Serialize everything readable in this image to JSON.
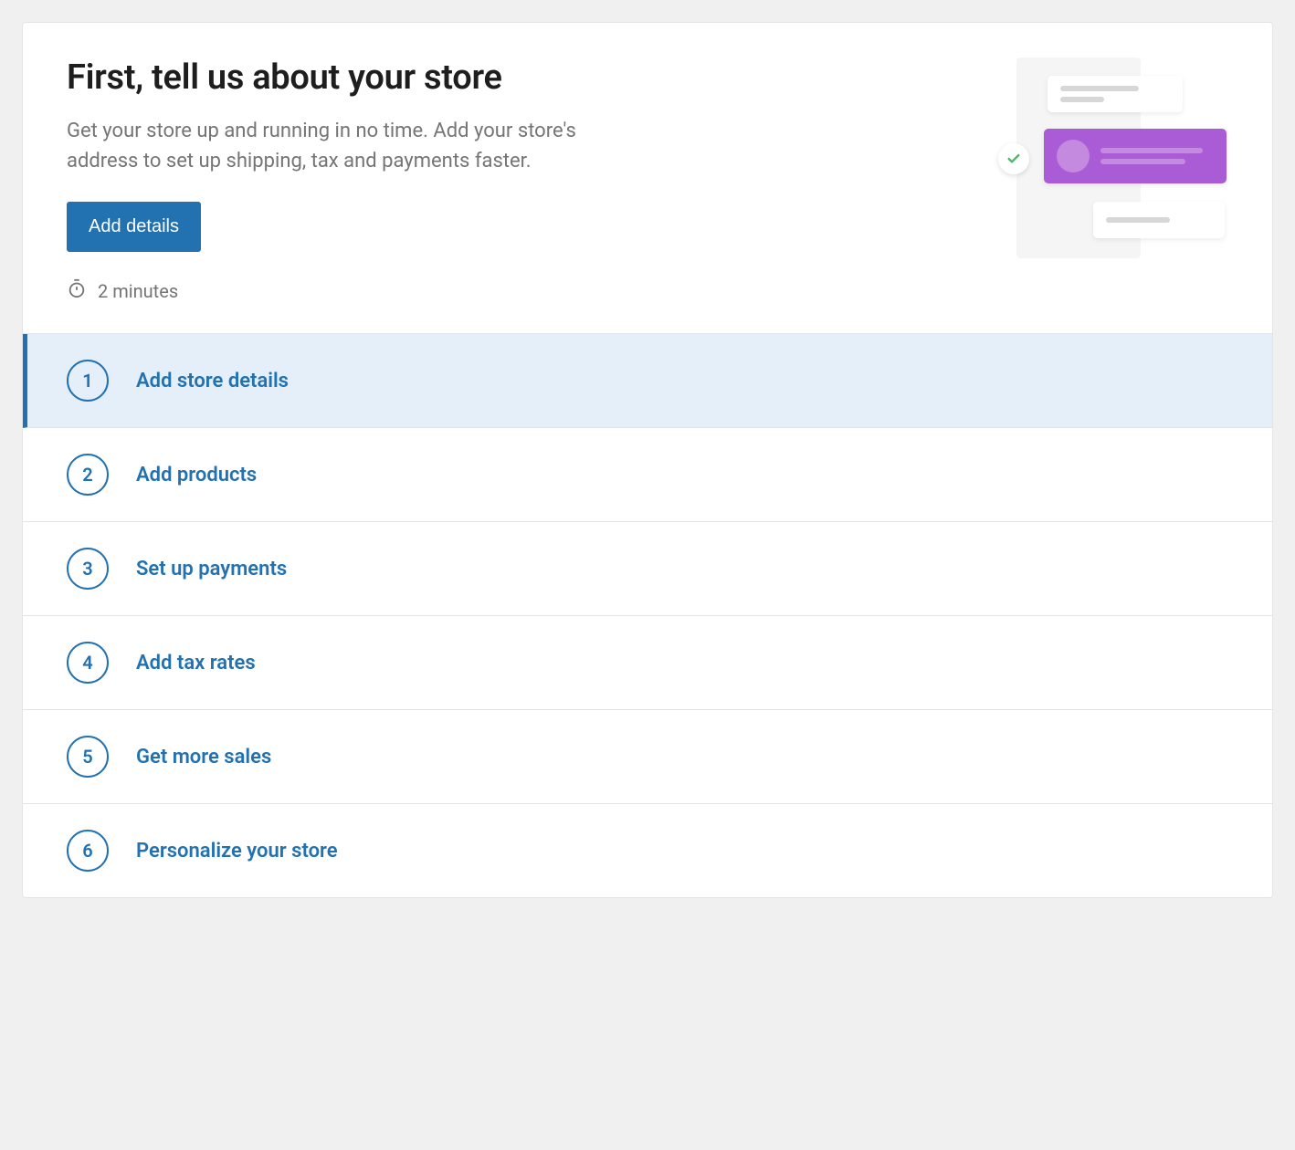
{
  "header": {
    "title": "First, tell us about your store",
    "description": "Get your store up and running in no time. Add your store's address to set up shipping, tax and payments faster.",
    "cta_label": "Add details",
    "time_estimate": "2 minutes"
  },
  "steps": [
    {
      "number": "1",
      "label": "Add store details",
      "active": true
    },
    {
      "number": "2",
      "label": "Add products",
      "active": false
    },
    {
      "number": "3",
      "label": "Set up payments",
      "active": false
    },
    {
      "number": "4",
      "label": "Add tax rates",
      "active": false
    },
    {
      "number": "5",
      "label": "Get more sales",
      "active": false
    },
    {
      "number": "6",
      "label": "Personalize your store",
      "active": false
    }
  ],
  "colors": {
    "primary": "#2271b1",
    "accent": "#a95cd6",
    "success": "#4ab866"
  }
}
